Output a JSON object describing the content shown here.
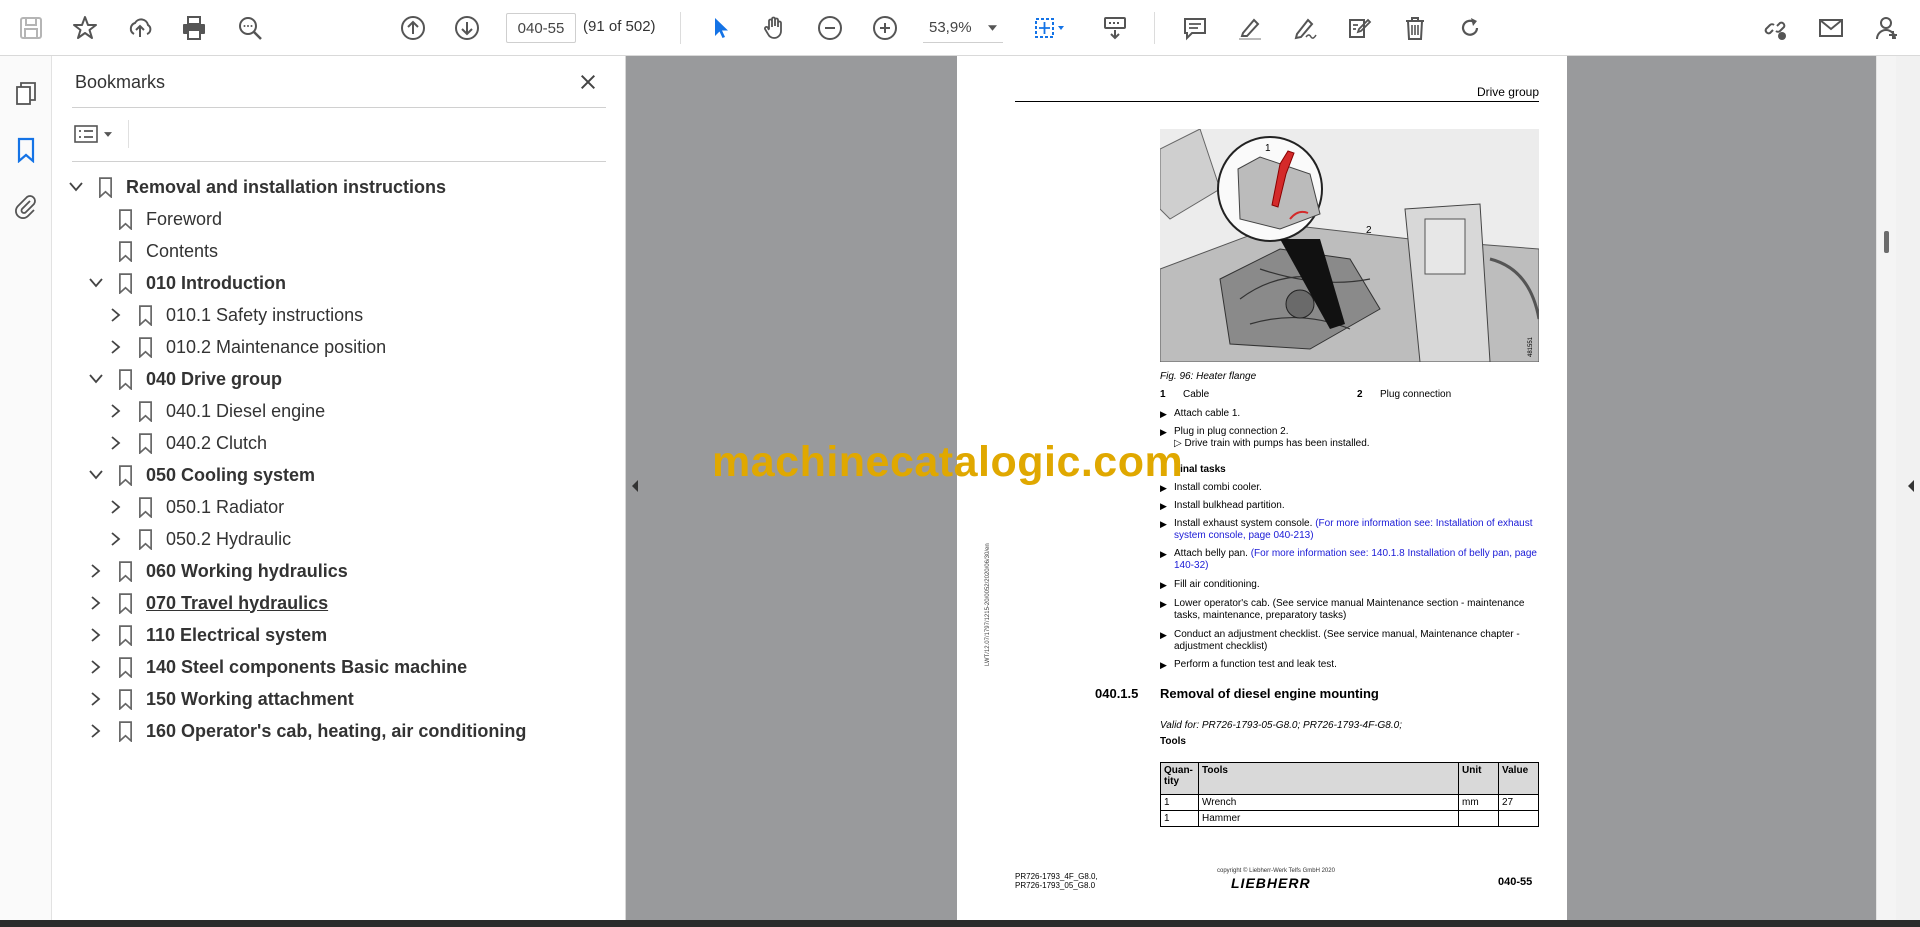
{
  "toolbar": {
    "page_value": "040-55",
    "page_count": "(91 of 502)",
    "zoom": "53,9%",
    "icons": [
      "save-icon",
      "star-icon",
      "upload-icon",
      "print-icon",
      "search-zoom-icon",
      "page-up-icon",
      "page-down-icon",
      "hand-tool-icon",
      "zoom-out-icon",
      "zoom-in-icon",
      "select-cursor-icon",
      "fit-page-icon",
      "scroll-mode-icon",
      "comment-icon",
      "highlight-icon",
      "sign-icon",
      "stamp-icon",
      "delete-icon",
      "rotate-icon",
      "share-link-icon",
      "mail-icon",
      "account-icon"
    ]
  },
  "bookmarks": {
    "title": "Bookmarks",
    "items": [
      {
        "label": "Removal and installation instructions",
        "level": 0,
        "expanded": true,
        "bold": true
      },
      {
        "label": "Foreword",
        "level": 1,
        "leaf": true
      },
      {
        "label": "Contents",
        "level": 1,
        "leaf": true
      },
      {
        "label": "010 Introduction",
        "level": 1,
        "expanded": true,
        "bold": true
      },
      {
        "label": "010.1 Safety instructions",
        "level": 2
      },
      {
        "label": "010.2 Maintenance position",
        "level": 2
      },
      {
        "label": "040 Drive group",
        "level": 1,
        "expanded": true,
        "bold": true
      },
      {
        "label": "040.1 Diesel engine",
        "level": 2
      },
      {
        "label": "040.2 Clutch",
        "level": 2
      },
      {
        "label": "050 Cooling system",
        "level": 1,
        "expanded": true,
        "bold": true
      },
      {
        "label": "050.1 Radiator",
        "level": 2
      },
      {
        "label": "050.2 Hydraulic",
        "level": 2
      },
      {
        "label": "060 Working hydraulics",
        "level": 1,
        "bold": true
      },
      {
        "label": "070 Travel hydraulics",
        "level": 1,
        "bold": true,
        "underline": true
      },
      {
        "label": "110 Electrical system",
        "level": 1,
        "bold": true
      },
      {
        "label": "140 Steel components Basic machine",
        "level": 1,
        "bold": true
      },
      {
        "label": "150 Working attachment",
        "level": 1,
        "bold": true
      },
      {
        "label": "160 Operator's cab, heating, air conditioning",
        "level": 1,
        "bold": true
      }
    ]
  },
  "page": {
    "header": "Drive group",
    "fig_caption": "Fig. 96: Heater flange",
    "fig_callout_1": "1",
    "fig_callout_2": "2",
    "fig_id": "481551",
    "legend": [
      {
        "num": "1",
        "text": "Cable"
      },
      {
        "num": "2",
        "text": "Plug connection"
      }
    ],
    "step1": "Attach cable 1.",
    "step2": "Plug in plug connection 2.",
    "step2_result": "▷ Drive train with pumps has been installed.",
    "final_heading": "Final tasks",
    "final_steps": [
      {
        "text": "Install combi cooler.",
        "link": ""
      },
      {
        "text": "Install bulkhead partition.",
        "link": ""
      },
      {
        "text": "Install exhaust system console. ",
        "link": "(For more information see: Installation of exhaust system console, page 040-213)"
      },
      {
        "text": "Attach belly pan. ",
        "link": "(For more information see: 140.1.8 Installation of belly pan, page 140-32)"
      },
      {
        "text": "Fill air conditioning.",
        "link": ""
      },
      {
        "text": "Lower operator's cab. (See service manual Maintenance section - maintenance tasks, maintenance, preparatory tasks)",
        "link": ""
      },
      {
        "text": "Conduct an adjustment checklist. (See service manual, Maintenance chapter - adjustment checklist)",
        "link": ""
      },
      {
        "text": "Perform a function test and leak test.",
        "link": ""
      }
    ],
    "section_number": "040.1.5",
    "section_title": "Removal of diesel engine mounting",
    "valid_for": "Valid for: PR726-1793-05-G8.0; PR726-1793-4F-G8.0;",
    "tools_heading": "Tools",
    "table_headers": [
      "Quan-tity",
      "Tools",
      "Unit",
      "Value"
    ],
    "table_rows": [
      [
        "1",
        "Wrench",
        "mm",
        "27"
      ],
      [
        "1",
        "Hammer",
        "",
        ""
      ]
    ],
    "side_note": "LWT/12.07/1797/1215-20/0052/2020/06/30/en",
    "footer_models": "PR726-1793_4F_G8.0,\nPR726-1793_05_G8.0",
    "footer_copyright": "copyright © Liebherr-Werk Telfs GmbH 2020",
    "footer_logo": "LIEBHERR",
    "footer_page": "040-55"
  },
  "watermark": "machinecatalogic.com",
  "colors": {
    "link": "#1a1ad6",
    "watermark": "#e0a800",
    "accent": "#1473e6",
    "doc_bg": "#999a9c"
  }
}
